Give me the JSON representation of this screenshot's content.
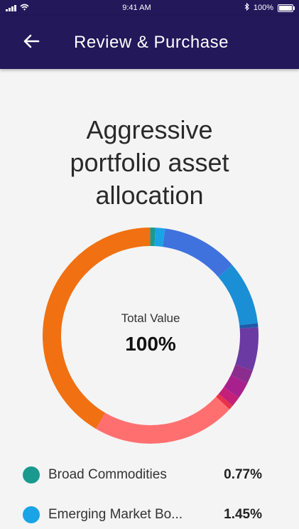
{
  "status_bar": {
    "time": "9:41 AM",
    "battery": "100%"
  },
  "header": {
    "title": "Review & Purchase"
  },
  "page": {
    "title_lines": [
      "Aggressive",
      "portfolio asset",
      "allocation"
    ]
  },
  "donut": {
    "center_label": "Total Value",
    "center_value": "100%"
  },
  "colors": {
    "nav_bg": "#22185a",
    "background": "#f4f4f4"
  },
  "legend": [
    {
      "name": "Broad Commodities",
      "value": "0.77%",
      "color": "#1a9a8e"
    },
    {
      "name": "Emerging Market Bo...",
      "value": "1.45%",
      "color": "#1aa4e6"
    }
  ],
  "chart_data": {
    "type": "pie",
    "categories": [
      "Broad Commodities",
      "Emerging Market Bo...",
      "",
      "",
      "",
      "",
      "",
      "",
      "",
      "",
      "",
      ""
    ],
    "values": [
      0.77,
      1.45,
      11.5,
      9.5,
      0.6,
      6.5,
      2.0,
      2.5,
      1.5,
      0.7,
      21.5,
      41.5
    ],
    "colors": [
      "#1a9a8e",
      "#1aa4e6",
      "#3f72dd",
      "#1a8fd6",
      "#1f5aa8",
      "#6b3aa3",
      "#8a2d8e",
      "#a8208e",
      "#c4207a",
      "#e8334a",
      "#ff6f6f",
      "#f07012"
    ]
  }
}
